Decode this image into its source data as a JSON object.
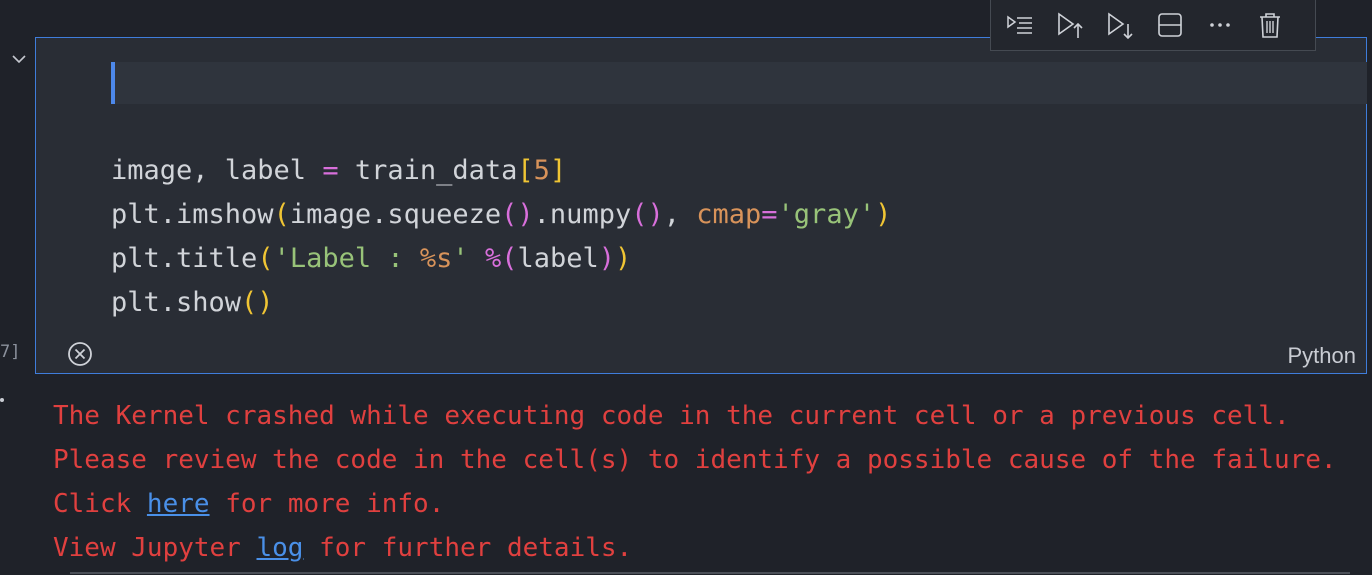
{
  "cell": {
    "execution_count": "7]",
    "language": "Python",
    "code_lines": [
      [
        {
          "t": "image, label ",
          "c": ""
        },
        {
          "t": "=",
          "c": "op"
        },
        {
          "t": " train_data",
          "c": ""
        },
        {
          "t": "[",
          "c": "br1"
        },
        {
          "t": "5",
          "c": "num"
        },
        {
          "t": "]",
          "c": "br1"
        }
      ],
      [
        {
          "t": "plt.imshow",
          "c": ""
        },
        {
          "t": "(",
          "c": "br1"
        },
        {
          "t": "image.squeeze",
          "c": ""
        },
        {
          "t": "()",
          "c": "br2"
        },
        {
          "t": ".numpy",
          "c": ""
        },
        {
          "t": "()",
          "c": "br2"
        },
        {
          "t": ", ",
          "c": ""
        },
        {
          "t": "cmap",
          "c": "kw"
        },
        {
          "t": "=",
          "c": "op"
        },
        {
          "t": "'gray'",
          "c": "str"
        },
        {
          "t": ")",
          "c": "br1"
        }
      ],
      [
        {
          "t": "plt.title",
          "c": ""
        },
        {
          "t": "(",
          "c": "br1"
        },
        {
          "t": "'Label : ",
          "c": "str"
        },
        {
          "t": "%s",
          "c": "num"
        },
        {
          "t": "'",
          "c": "str"
        },
        {
          "t": " ",
          "c": ""
        },
        {
          "t": "%",
          "c": "op"
        },
        {
          "t": "(",
          "c": "br2"
        },
        {
          "t": "label",
          "c": ""
        },
        {
          "t": ")",
          "c": "br2"
        },
        {
          "t": ")",
          "c": "br1"
        }
      ],
      [
        {
          "t": "plt.show",
          "c": ""
        },
        {
          "t": "()",
          "c": "br1"
        }
      ]
    ]
  },
  "toolbar": {
    "buttons": [
      {
        "name": "run-by-line-icon"
      },
      {
        "name": "run-above-icon"
      },
      {
        "name": "run-below-icon"
      },
      {
        "name": "split-cell-icon"
      },
      {
        "name": "more-actions-icon"
      },
      {
        "name": "delete-cell-icon"
      }
    ]
  },
  "output": {
    "line1": "The Kernel crashed while executing code in the current cell or a previous cell.",
    "line2": "Please review the code in the cell(s) to identify a possible cause of the failure.",
    "line3_prefix": "Click ",
    "line3_link": "here",
    "line3_suffix": " for more info.",
    "line4_prefix": "View Jupyter ",
    "line4_link": "log",
    "line4_suffix": " for further details."
  },
  "colors": {
    "cell_border": "#3f7ddb",
    "error_text": "#e0403f",
    "link": "#4a90e8"
  }
}
